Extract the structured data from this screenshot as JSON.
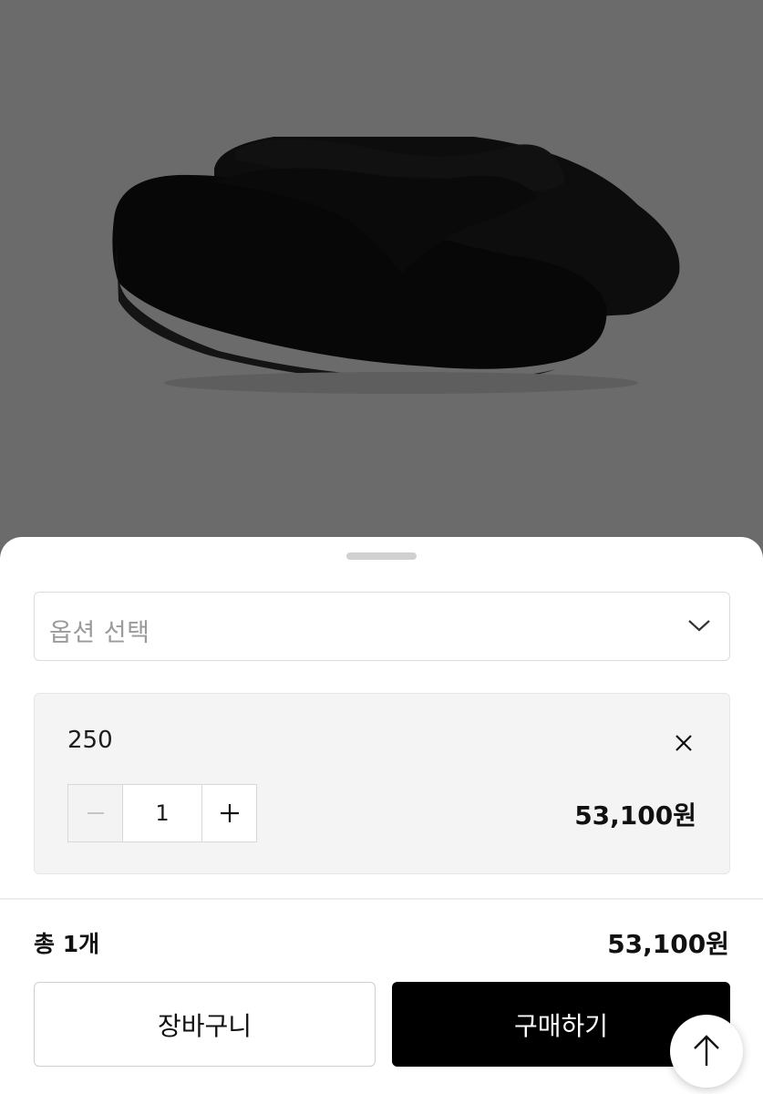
{
  "product": {
    "image": "black-foam-flip-flop-sandals"
  },
  "sheet": {
    "option_select": {
      "placeholder": "옵션 선택",
      "icon": "chevron-down-icon"
    },
    "selected_item": {
      "size": "250",
      "quantity": "1",
      "price": "53,100원",
      "remove_icon": "close-icon",
      "minus_icon": "minus-icon",
      "plus_icon": "plus-icon"
    },
    "summary": {
      "count_label": "총 1개",
      "total_price": "53,100원"
    },
    "buttons": {
      "cart_label": "장바구니",
      "buy_label": "구매하기"
    },
    "scroll_top_icon": "arrow-up-icon"
  },
  "colors": {
    "backdrop": "#6b6b6b",
    "buy_button": "#000000",
    "panel_bg": "#f4f4f4"
  }
}
